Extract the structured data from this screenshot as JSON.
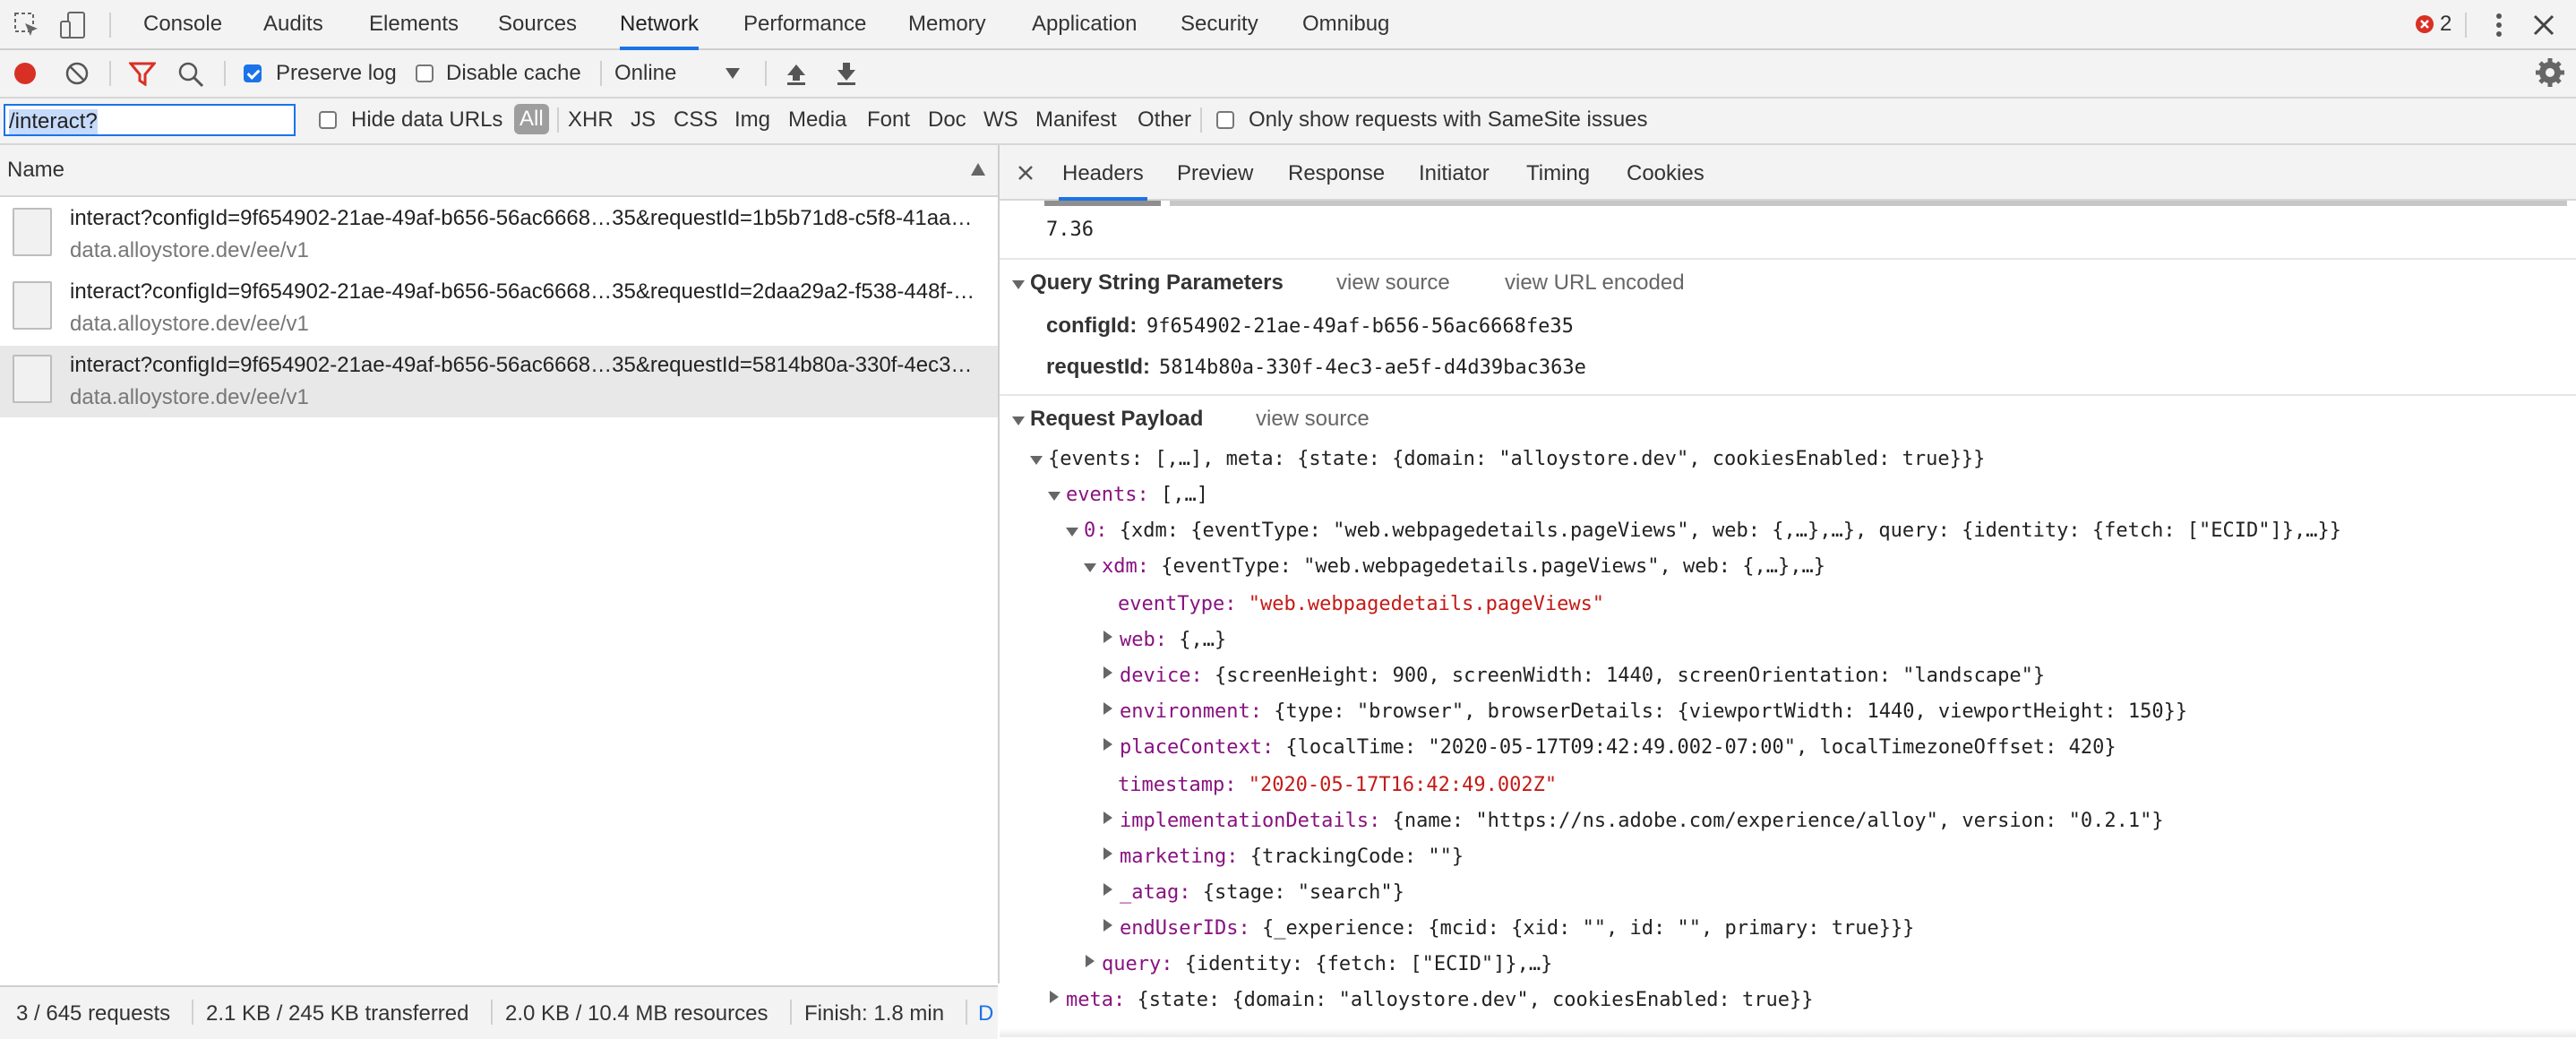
{
  "top_tabs": [
    "Console",
    "Audits",
    "Elements",
    "Sources",
    "Network",
    "Performance",
    "Memory",
    "Application",
    "Security",
    "Omnibug"
  ],
  "error_count": "2",
  "toolbar": {
    "preserve_log": "Preserve log",
    "disable_cache": "Disable cache",
    "throttle": "Online"
  },
  "filter": {
    "value": "/interact?",
    "hide_data_urls": "Hide data URLs",
    "types": [
      "All",
      "XHR",
      "JS",
      "CSS",
      "Img",
      "Media",
      "Font",
      "Doc",
      "WS",
      "Manifest",
      "Other"
    ],
    "samesite": "Only show requests with SameSite issues"
  },
  "list": {
    "header": "Name",
    "requests": [
      {
        "name": "interact?configId=9f654902-21ae-49af-b656-56ac6668…35&requestId=1b5b71d8-c5f8-41aa…",
        "domain": "data.alloystore.dev/ee/v1"
      },
      {
        "name": "interact?configId=9f654902-21ae-49af-b656-56ac6668…35&requestId=2daa29a2-f538-448f-…",
        "domain": "data.alloystore.dev/ee/v1"
      },
      {
        "name": "interact?configId=9f654902-21ae-49af-b656-56ac6668…35&requestId=5814b80a-330f-4ec3…",
        "domain": "data.alloystore.dev/ee/v1"
      }
    ]
  },
  "status": {
    "requests": "3 / 645 requests",
    "transferred": "2.1 KB / 245 KB transferred",
    "resources": "2.0 KB / 10.4 MB resources",
    "finish": "Finish: 1.8 min",
    "extra": "D"
  },
  "detail_tabs": [
    "Headers",
    "Preview",
    "Response",
    "Initiator",
    "Timing",
    "Cookies"
  ],
  "ua_tail": "7.36",
  "query": {
    "title": "Query String Parameters",
    "view_source": "view source",
    "view_encoded": "view URL encoded",
    "params": [
      {
        "key": "configId:",
        "value": "9f654902-21ae-49af-b656-56ac6668fe35"
      },
      {
        "key": "requestId:",
        "value": "5814b80a-330f-4ec3-ae5f-d4d39bac363e"
      }
    ]
  },
  "payload": {
    "title": "Request Payload",
    "view_source": "view source",
    "root": "{events: [,…], meta: {state: {domain: \"alloystore.dev\", cookiesEnabled: true}}}",
    "events_key": "events:",
    "events_val": " [,…]",
    "e0_key": "0:",
    "e0_val": " {xdm: {eventType: \"web.webpagedetails.pageViews\", web: {,…},…}, query: {identity: {fetch: [\"ECID\"]},…}}",
    "xdm_key": "xdm:",
    "xdm_val": " {eventType: \"web.webpagedetails.pageViews\", web: {,…},…}",
    "eventType_key": "eventType:",
    "eventType_val": "\"web.webpagedetails.pageViews\"",
    "web_key": "web:",
    "web_val": " {,…}",
    "device_key": "device:",
    "device_val": " {screenHeight: 900, screenWidth: 1440, screenOrientation: \"landscape\"}",
    "env_key": "environment:",
    "env_val": " {type: \"browser\", browserDetails: {viewportWidth: 1440, viewportHeight: 150}}",
    "place_key": "placeContext:",
    "place_val": " {localTime: \"2020-05-17T09:42:49.002-07:00\", localTimezoneOffset: 420}",
    "ts_key": "timestamp:",
    "ts_val": "\"2020-05-17T16:42:49.002Z\"",
    "impl_key": "implementationDetails:",
    "impl_val": " {name: \"https://ns.adobe.com/experience/alloy\", version: \"0.2.1\"}",
    "mkt_key": "marketing:",
    "mkt_val": " {trackingCode: \"\"}",
    "atag_key": "_atag:",
    "atag_val": " {stage: \"search\"}",
    "euid_key": "endUserIDs:",
    "euid_val": " {_experience: {mcid: {xid: \"\", id: \"\", primary: true}}}",
    "query_key": "query:",
    "query_val": " {identity: {fetch: [\"ECID\"]},…}",
    "meta_key": "meta:",
    "meta_val": " {state: {domain: \"alloystore.dev\", cookiesEnabled: true}}"
  },
  "colors": {
    "accent": "#1a73e8",
    "record": "#d93025",
    "json_key": "#881280",
    "json_string": "#c41a16"
  }
}
